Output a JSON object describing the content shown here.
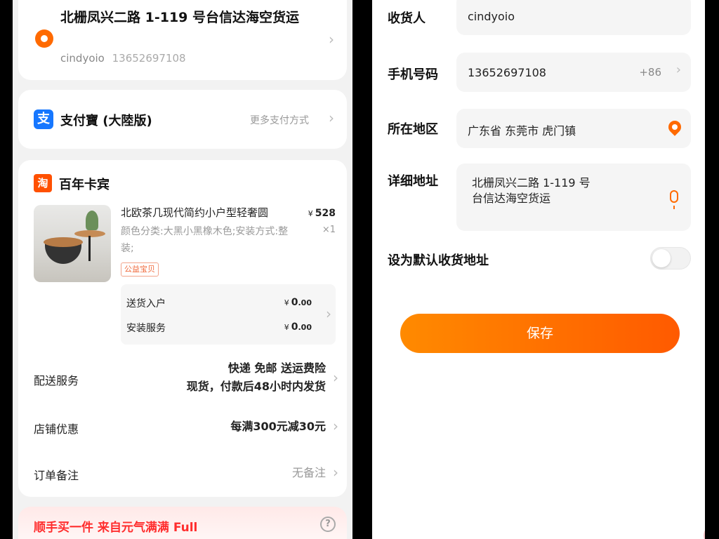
{
  "left": {
    "address": {
      "title": "北栅凤兴二路 1-119 号台信达海空货运",
      "name": "cindyoio",
      "phone": "13652697108"
    },
    "payment": {
      "method": "支付寶 (大陸版)",
      "more": "更多支付方式"
    },
    "shop": {
      "icon_text": "淘",
      "name": "百年卡宾"
    },
    "product": {
      "title": "北欧茶几现代简约小户型轻奢圆",
      "spec": "颜色分类:大黑小黑橡木色;安装方式:整装;",
      "price_symbol": "¥",
      "price": "528",
      "qty": "×1",
      "tag": "公益宝贝"
    },
    "services": [
      {
        "label": "送货入户",
        "symbol": "¥",
        "int": "0",
        "dec": ".00"
      },
      {
        "label": "安装服务",
        "symbol": "¥",
        "int": "0",
        "dec": ".00"
      }
    ],
    "rows": {
      "delivery_label": "配送服务",
      "delivery_line1": "快递 免邮 送运费险",
      "delivery_line2": "现货，付款后48小时内发货",
      "discount_label": "店铺优惠",
      "discount_value": "每满300元减30元",
      "note_label": "订单备注",
      "note_value": "无备注"
    },
    "promo": {
      "text": "顺手买一件 来自元气满满 Full"
    }
  },
  "right": {
    "fields": {
      "receiver_label": "收货人",
      "receiver_value": "cindyoio",
      "phone_label": "手机号码",
      "phone_value": "13652697108",
      "country_code": "+86",
      "region_label": "所在地区",
      "region_value": "广东省 东莞市 虎门镇",
      "detail_label": "详细地址",
      "detail_line1": "北栅凤兴二路 1-119 号",
      "detail_line2": "台信达海空货运",
      "default_label": "设为默认收货地址"
    },
    "save_label": "保存"
  },
  "colors": {
    "accent": "#ff6a00",
    "alipay": "#1677ff",
    "promo_red": "#ff2d2d"
  },
  "icons": [
    "location-pin-icon",
    "alipay-icon",
    "taobao-shop-icon",
    "chevron-right-icon",
    "help-icon",
    "microphone-icon"
  ],
  "state": {
    "default_address_enabled": false
  }
}
